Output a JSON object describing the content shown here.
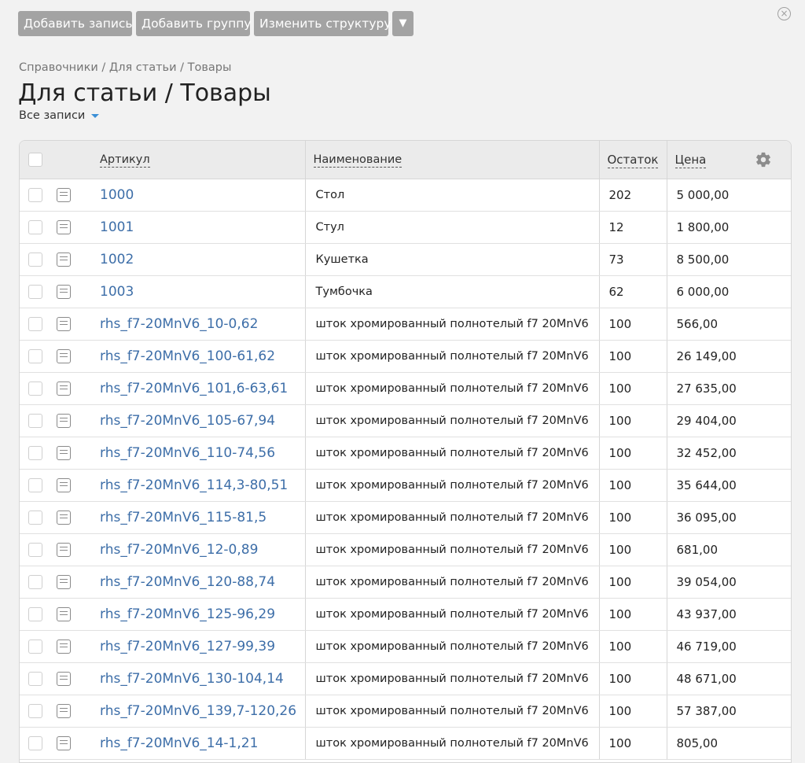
{
  "toolbar": {
    "add_record": "Добавить запись",
    "add_group": "Добавить группу",
    "change_structure": "Изменить структуру",
    "more": "▼"
  },
  "close_icon": "×",
  "breadcrumb": "Справочники / Для статьи / Товары",
  "title": "Для статьи / Товары",
  "filter": "Все записи",
  "table": {
    "headers": {
      "sku": "Артикул",
      "name": "Наименование",
      "stock": "Остаток",
      "price": "Цена"
    },
    "rows": [
      {
        "sku": "1000",
        "name": "Стол",
        "stock": "202",
        "price": "5 000,00"
      },
      {
        "sku": "1001",
        "name": "Стул",
        "stock": "12",
        "price": "1 800,00"
      },
      {
        "sku": "1002",
        "name": "Кушетка",
        "stock": "73",
        "price": "8 500,00"
      },
      {
        "sku": "1003",
        "name": "Тумбочка",
        "stock": "62",
        "price": "6 000,00"
      },
      {
        "sku": "rhs_f7-20MnV6_10-0,62",
        "name": "шток хромированный полнотелый f7 20MnV6",
        "stock": "100",
        "price": "566,00"
      },
      {
        "sku": "rhs_f7-20MnV6_100-61,62",
        "name": "шток хромированный полнотелый f7 20MnV6",
        "stock": "100",
        "price": "26 149,00"
      },
      {
        "sku": "rhs_f7-20MnV6_101,6-63,61",
        "name": "шток хромированный полнотелый f7 20MnV6",
        "stock": "100",
        "price": "27 635,00"
      },
      {
        "sku": "rhs_f7-20MnV6_105-67,94",
        "name": "шток хромированный полнотелый f7 20MnV6",
        "stock": "100",
        "price": "29 404,00"
      },
      {
        "sku": "rhs_f7-20MnV6_110-74,56",
        "name": "шток хромированный полнотелый f7 20MnV6",
        "stock": "100",
        "price": "32 452,00"
      },
      {
        "sku": "rhs_f7-20MnV6_114,3-80,51",
        "name": "шток хромированный полнотелый f7 20MnV6",
        "stock": "100",
        "price": "35 644,00"
      },
      {
        "sku": "rhs_f7-20MnV6_115-81,5",
        "name": "шток хромированный полнотелый f7 20MnV6",
        "stock": "100",
        "price": "36 095,00"
      },
      {
        "sku": "rhs_f7-20MnV6_12-0,89",
        "name": "шток хромированный полнотелый f7 20MnV6",
        "stock": "100",
        "price": "681,00"
      },
      {
        "sku": "rhs_f7-20MnV6_120-88,74",
        "name": "шток хромированный полнотелый f7 20MnV6",
        "stock": "100",
        "price": "39 054,00"
      },
      {
        "sku": "rhs_f7-20MnV6_125-96,29",
        "name": "шток хромированный полнотелый f7 20MnV6",
        "stock": "100",
        "price": "43 937,00"
      },
      {
        "sku": "rhs_f7-20MnV6_127-99,39",
        "name": "шток хромированный полнотелый f7 20MnV6",
        "stock": "100",
        "price": "46 719,00"
      },
      {
        "sku": "rhs_f7-20MnV6_130-104,14",
        "name": "шток хромированный полнотелый f7 20MnV6",
        "stock": "100",
        "price": "48 671,00"
      },
      {
        "sku": "rhs_f7-20MnV6_139,7-120,26",
        "name": "шток хромированный полнотелый f7 20MnV6",
        "stock": "100",
        "price": "57 387,00"
      },
      {
        "sku": "rhs_f7-20MnV6_14-1,21",
        "name": "шток хромированный полнотелый f7 20MnV6",
        "stock": "100",
        "price": "805,00"
      }
    ]
  }
}
